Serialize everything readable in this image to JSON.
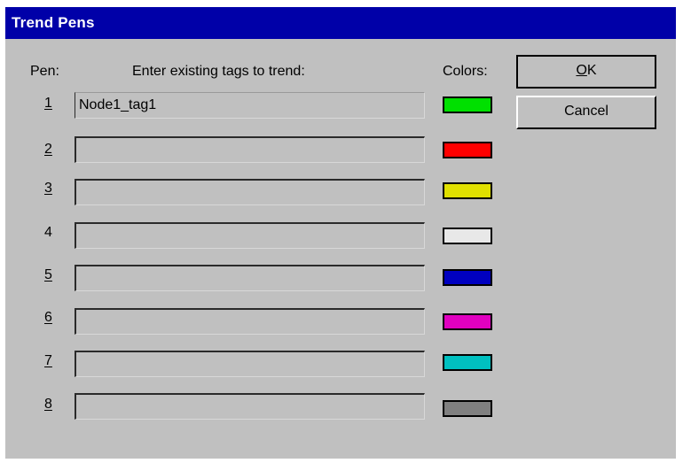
{
  "window": {
    "title": "Trend Pens"
  },
  "headers": {
    "pen": "Pen:",
    "tags": "Enter existing tags to trend:",
    "colors": "Colors:"
  },
  "pens": [
    {
      "number": "1",
      "tag": "Node1_tag1",
      "color": "#00e000"
    },
    {
      "number": "2",
      "tag": "",
      "color": "#ff0000"
    },
    {
      "number": "3",
      "tag": "",
      "color": "#e0e000"
    },
    {
      "number": "4",
      "tag": "",
      "color": "#e8e8e8"
    },
    {
      "number": "5",
      "tag": "",
      "color": "#0000c0"
    },
    {
      "number": "6",
      "tag": "",
      "color": "#e000c0"
    },
    {
      "number": "7",
      "tag": "",
      "color": "#00c0c0"
    },
    {
      "number": "8",
      "tag": "",
      "color": "#808080"
    }
  ],
  "buttons": {
    "ok_mnemonic": "O",
    "ok_rest": "K",
    "cancel": "Cancel"
  }
}
